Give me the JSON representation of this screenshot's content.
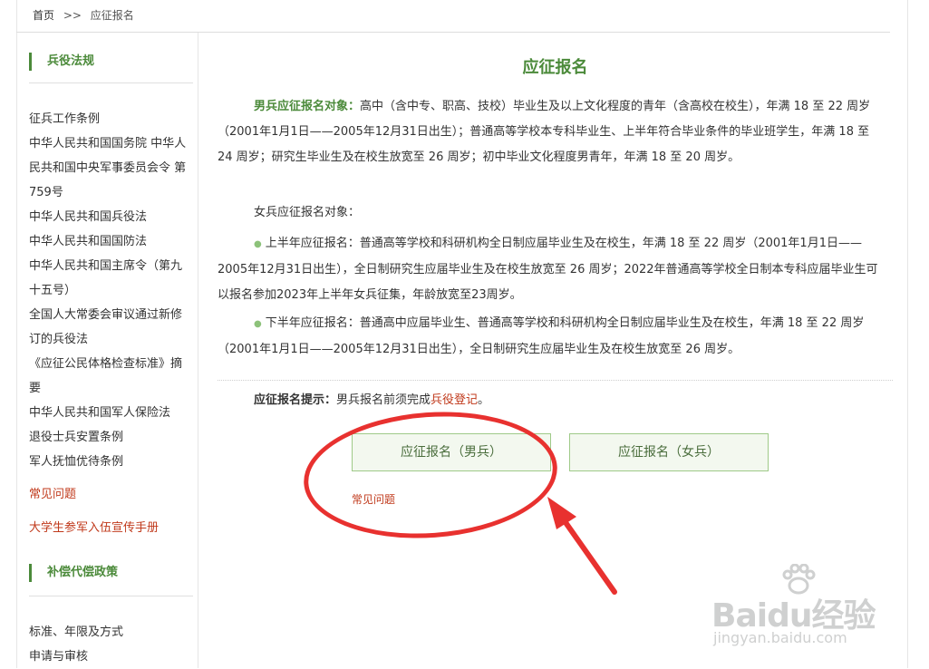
{
  "breadcrumb": {
    "home": "首页",
    "sep": ">>",
    "current": "应征报名"
  },
  "sidebar": {
    "section1_title": "兵役法规",
    "items": [
      "征兵工作条例",
      "中华人民共和国国务院 中华人民共和国中央军事委员会令 第759号",
      "中华人民共和国兵役法",
      "中华人民共和国国防法",
      "中华人民共和国主席令（第九十五号）",
      "全国人大常委会审议通过新修订的兵役法",
      "《应征公民体格检查标准》摘要",
      "中华人民共和国军人保险法",
      "退役士兵安置条例",
      "军人抚恤优待条例"
    ],
    "faq_link": "常见问题",
    "handbook_link": "大学生参军入伍宣传手册",
    "section2_title": "补偿代偿政策",
    "items2": [
      "标准、年限及方式",
      "申请与审核"
    ]
  },
  "main": {
    "title": "应征报名",
    "male_label": "男兵应征报名对象：",
    "male_text": "高中（含中专、职高、技校）毕业生及以上文化程度的青年（含高校在校生），年满 18 至 22 周岁（2001年1月1日——2005年12月31日出生）；普通高等学校本专科毕业生、上半年符合毕业条件的毕业班学生，年满 18 至 24 周岁；研究生毕业生及在校生放宽至 26 周岁；初中毕业文化程度男青年，年满 18 至 20 周岁。",
    "female_label": "女兵应征报名对象：",
    "female_first": "上半年应征报名：普通高等学校和科研机构全日制应届毕业生及在校生，年满 18 至 22 周岁（2001年1月1日——2005年12月31日出生），全日制研究生应届毕业生及在校生放宽至 26 周岁；2022年普通高等学校全日制本专科应届毕业生可以报名参加2023年上半年女兵征集，年龄放宽至23周岁。",
    "female_second": "下半年应征报名：普通高中应届毕业生、普通高等学校和科研机构全日制应届毕业生及在校生，年满 18 至 22 周岁（2001年1月1日——2005年12月31日出生），全日制研究生应届毕业生及在校生放宽至 26 周岁。",
    "hint_label": "应征报名提示：",
    "hint_text": "男兵报名前须完成",
    "hint_link": "兵役登记",
    "hint_end": "。",
    "btn_male": "应征报名（男兵）",
    "btn_female": "应征报名（女兵）",
    "faq": "常见问题"
  },
  "watermark": {
    "brand": "Baidu经验",
    "url": "jingyan.baidu.com"
  },
  "colors": {
    "accent_green": "#4b8a3a",
    "link_red": "#c0391b",
    "annotation_red": "#e8312f"
  }
}
